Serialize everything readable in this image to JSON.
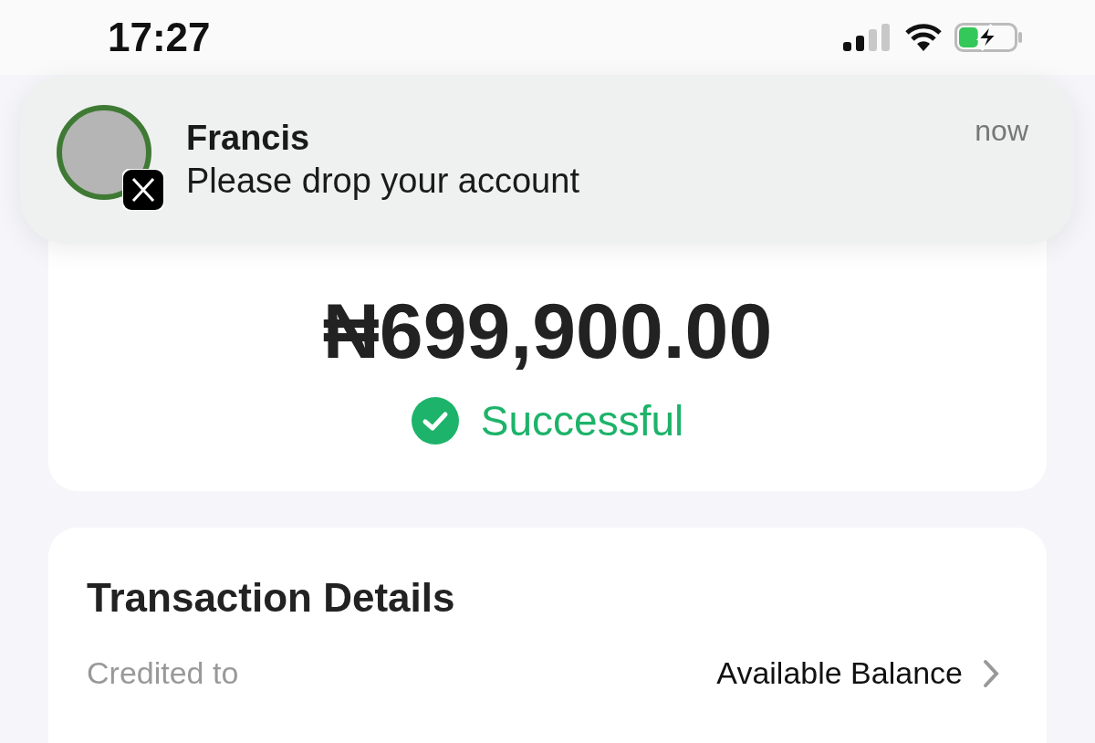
{
  "status_bar": {
    "time": "17:27",
    "battery": {
      "charging": true,
      "level": 0.35
    }
  },
  "notification": {
    "sender": "Francis",
    "message": "Please drop your account",
    "time": "now"
  },
  "transaction": {
    "amount": "₦699,900.00",
    "status": "Successful"
  },
  "details": {
    "title": "Transaction Details",
    "rows": [
      {
        "label": "Credited to",
        "value": "Available Balance"
      }
    ]
  }
}
